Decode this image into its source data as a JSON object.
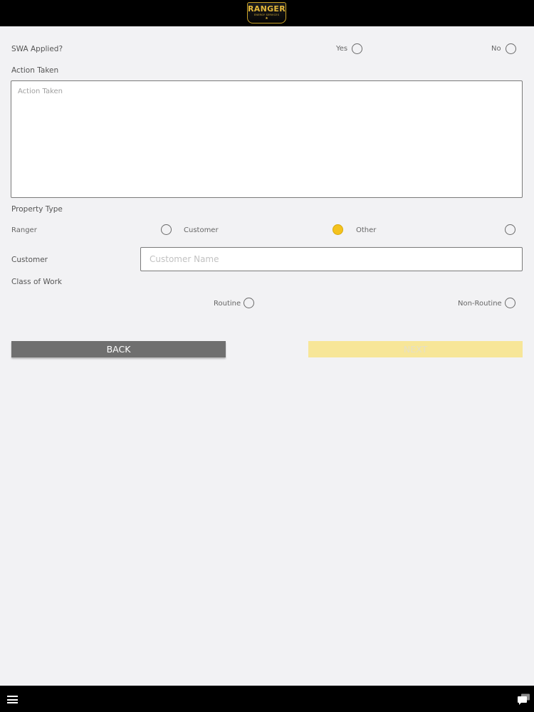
{
  "header": {
    "logo": {
      "brand": "RANGER",
      "tagline": "ENERGY SERVICES",
      "mark": "★"
    }
  },
  "form": {
    "swa": {
      "label": "SWA Applied?",
      "options": [
        {
          "label": "Yes",
          "selected": false
        },
        {
          "label": "No",
          "selected": false
        }
      ]
    },
    "action_taken": {
      "label": "Action Taken",
      "placeholder": "Action Taken",
      "value": ""
    },
    "property_type": {
      "label": "Property Type",
      "options": [
        {
          "label": "Ranger",
          "selected": false
        },
        {
          "label": "Customer",
          "selected": true
        },
        {
          "label": "Other",
          "selected": false
        }
      ]
    },
    "customer": {
      "label": "Customer",
      "placeholder": "Customer Name",
      "value": ""
    },
    "class_of_work": {
      "label": "Class of Work",
      "options": [
        {
          "label": "Routine",
          "selected": false
        },
        {
          "label": "Non-Routine",
          "selected": false
        }
      ]
    }
  },
  "buttons": {
    "back": "BACK",
    "next": "NEXT"
  },
  "colors": {
    "accent": "#f4c21d",
    "next_disabled": "#f7e698",
    "back": "#6f6f6f",
    "bar": "#000000"
  },
  "icons": {
    "menu": "hamburger-icon",
    "chat": "chat-icon"
  }
}
